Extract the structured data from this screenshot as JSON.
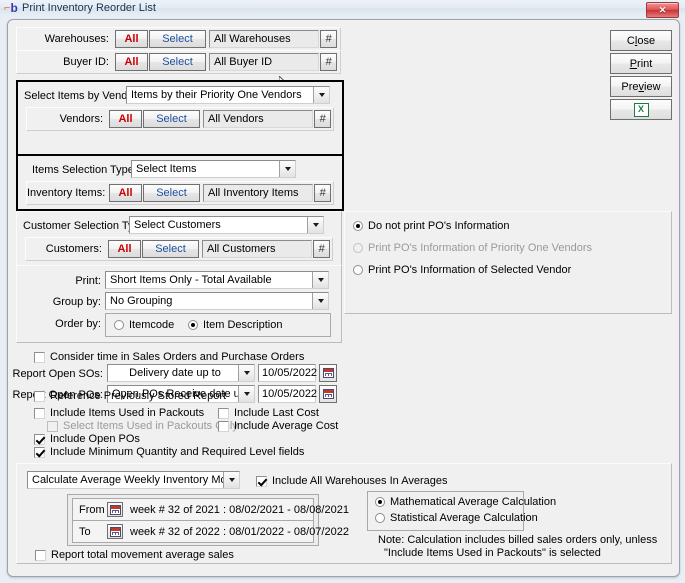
{
  "window": {
    "title": "Print Inventory Reorder List",
    "icon": "beas-icon",
    "close_label": "✕"
  },
  "actions": [
    {
      "id": "close",
      "label": "Close",
      "accel_index": 1
    },
    {
      "id": "print",
      "label": "Print",
      "accel_index": 0
    },
    {
      "id": "preview",
      "label": "Preview",
      "accel_index": 3
    },
    {
      "id": "excel",
      "label": "X",
      "icon": "excel-export-icon"
    }
  ],
  "selectors": {
    "warehouses": {
      "label": "Warehouses:",
      "all": "All",
      "select": "Select",
      "value": "All Warehouses",
      "hash": "#"
    },
    "buyer_id": {
      "label": "Buyer ID:",
      "all": "All",
      "select": "Select",
      "value": "All Buyer ID",
      "hash": "#"
    },
    "vendors": {
      "label": "Vendors:",
      "all": "All",
      "select": "Select",
      "value": "All Vendors",
      "hash": "#"
    },
    "inventory_items": {
      "label": "Inventory Items:",
      "all": "All",
      "select": "Select",
      "value": "All Inventory Items",
      "hash": "#"
    },
    "customers": {
      "label": "Customers:",
      "all": "All",
      "select": "Select",
      "value": "All Customers",
      "hash": "#"
    }
  },
  "combos": {
    "select_items_by_vendor": {
      "label": "Select Items by Vendor",
      "value": "Items by their Priority One Vendors"
    },
    "items_selection_type": {
      "label": "Items Selection Type:",
      "value": "Select Items"
    },
    "customer_selection_type": {
      "label": "Customer Selection Type:",
      "value": "Select Customers"
    },
    "print": {
      "label": "Print:",
      "value": "Short Items Only - Total Available"
    },
    "group_by": {
      "label": "Group by:",
      "value": "No Grouping"
    },
    "average_movement": {
      "value": "Calculate Average Weekly Inventory Movement"
    }
  },
  "order_by": {
    "label": "Order by:",
    "options": [
      {
        "label": "Itemcode",
        "selected": false
      },
      {
        "label": "Item Description",
        "selected": true
      }
    ]
  },
  "po_info": {
    "options": [
      {
        "label": "Do not print PO's Information",
        "selected": true,
        "disabled": false
      },
      {
        "label": "Print PO's Information of Priority One Vendors",
        "selected": false,
        "disabled": true
      },
      {
        "label": "Print PO's Information of Selected Vendor",
        "selected": false,
        "disabled": false
      }
    ]
  },
  "time_options": {
    "consider_time": {
      "label": "Consider time in Sales Orders and Purchase Orders",
      "checked": false
    },
    "report_open_sos": {
      "label": "Report Open SOs:",
      "value": "Delivery date up to",
      "date": "10/05/2022"
    },
    "report_open_pos": {
      "label": "Report Open POs:",
      "value": "Open POs Receive date up to",
      "date": "10/05/2022"
    }
  },
  "checkboxes": {
    "reference_stored_report": {
      "label": "Reference Previously Stored Report",
      "checked": false,
      "disabled": false
    },
    "include_items_packouts": {
      "label": "Include Items Used in Packouts",
      "checked": false,
      "disabled": false
    },
    "select_items_packouts_only": {
      "label": "Select Items Used in Packouts Only",
      "checked": false,
      "disabled": true
    },
    "include_open_pos": {
      "label": "Include Open POs",
      "checked": true,
      "disabled": false
    },
    "include_min_qty": {
      "label": "Include Minimum Quantity and Required Level fields",
      "checked": true,
      "disabled": false
    },
    "include_last_cost": {
      "label": "Include Last Cost",
      "checked": false,
      "disabled": false
    },
    "include_average_cost": {
      "label": "Include Average Cost",
      "checked": false,
      "disabled": false
    },
    "include_all_warehouses": {
      "label": "Include All Warehouses In Averages",
      "checked": true,
      "disabled": false
    },
    "report_total_movement": {
      "label": "Report total movement average sales",
      "checked": false,
      "disabled": false
    }
  },
  "week_range": {
    "from": {
      "label": "From",
      "value": "week # 32 of 2021 : 08/02/2021 - 08/08/2021"
    },
    "to": {
      "label": "To",
      "value": "week # 32 of 2022 : 08/01/2022 - 08/07/2022"
    }
  },
  "average_calc": {
    "options": [
      {
        "label": "Mathematical Average Calculation",
        "selected": true
      },
      {
        "label": "Statistical Average Calculation",
        "selected": false
      }
    ],
    "note_line1": "Note:  Calculation includes billed sales orders only, unless",
    "note_line2": "\"Include Items Used in Packouts\" is selected"
  },
  "colors": {
    "accent_red": "#cc0000",
    "link_blue": "#1b4f9c",
    "window_bg": "#e9eef4",
    "form_bg": "#f0f0f0",
    "excel_green": "#1e7a43"
  }
}
